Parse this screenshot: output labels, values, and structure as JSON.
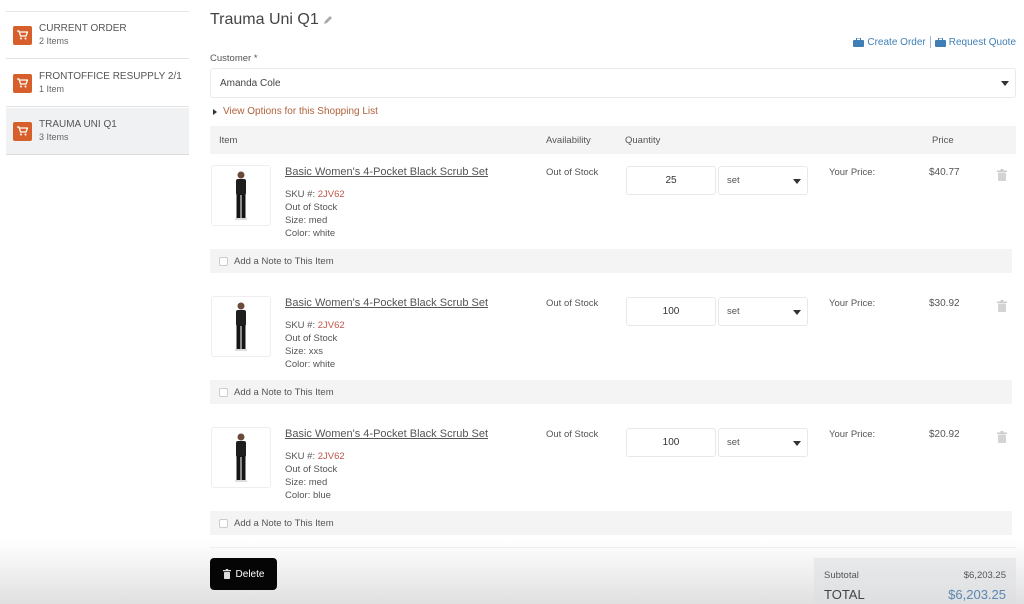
{
  "sidebar": {
    "items": [
      {
        "title": "CURRENT ORDER",
        "count": "2 Items",
        "active": false
      },
      {
        "title": "FRONTOFFICE RESUPPLY 2/1",
        "count": "1 Item",
        "active": false
      },
      {
        "title": "TRAUMA UNI Q1",
        "count": "3 Items",
        "active": true
      }
    ],
    "icon": "cart-icon",
    "icon_color": "#d65f2c"
  },
  "header": {
    "title": "Trauma Uni Q1",
    "edit_icon": "pencil-icon",
    "actions": {
      "create_order": "Create Order",
      "request_quote": "Request Quote",
      "icon": "briefcase-icon",
      "color": "#3f7fb6"
    }
  },
  "customer": {
    "label": "Customer *",
    "value": "Amanda Cole"
  },
  "view_options": "View Options for this Shopping List",
  "table": {
    "headers": {
      "item": "Item",
      "availability": "Availability",
      "quantity": "Quantity",
      "price": "Price"
    },
    "rows": [
      {
        "name": "Basic Women's 4-Pocket Black Scrub Set",
        "sku_label": "SKU #:",
        "sku": "2JV62",
        "stock": "Out of Stock",
        "size": "Size: med",
        "color": "Color: white",
        "availability": "Out of Stock",
        "quantity": "25",
        "unit": "set",
        "price_label": "Your Price:",
        "price": "$40.77",
        "note": "Add a Note to This Item"
      },
      {
        "name": "Basic Women's 4-Pocket Black Scrub Set",
        "sku_label": "SKU #:",
        "sku": "2JV62",
        "stock": "Out of Stock",
        "size": "Size: xxs",
        "color": "Color: white",
        "availability": "Out of Stock",
        "quantity": "100",
        "unit": "set",
        "price_label": "Your Price:",
        "price": "$30.92",
        "note": "Add a Note to This Item"
      },
      {
        "name": "Basic Women's 4-Pocket Black Scrub Set",
        "sku_label": "SKU #:",
        "sku": "2JV62",
        "stock": "Out of Stock",
        "size": "Size: med",
        "color": "Color: blue",
        "availability": "Out of Stock",
        "quantity": "100",
        "unit": "set",
        "price_label": "Your Price:",
        "price": "$20.92",
        "note": "Add a Note to This Item"
      }
    ]
  },
  "footer": {
    "delete_label": "Delete",
    "subtotal_label": "Subtotal",
    "subtotal": "$6,203.25",
    "total_label": "TOTAL",
    "total": "$6,203.25"
  }
}
